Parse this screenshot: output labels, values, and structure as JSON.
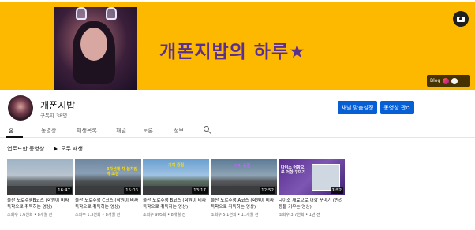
{
  "banner": {
    "title": "개폰지밥의 하루★",
    "links_label": "Blog",
    "camera_icon": "camera-icon",
    "colors": {
      "background": "#fdb800",
      "title": "#5a2f8f"
    }
  },
  "channel": {
    "name": "개폰지밥",
    "subscribers": "구독자 38명",
    "customize_button": "채널 맞춤설정",
    "manage_button": "동영상 관리",
    "accent": "#065fd4"
  },
  "tabs": [
    "홈",
    "동영상",
    "재생목록",
    "채널",
    "토론",
    "정보"
  ],
  "active_tab": "홈",
  "section": {
    "title": "업로드한 동영상",
    "play_all": "모두 재생"
  },
  "videos": [
    {
      "title": "울산 도로주행B코스 (학원이 비싸 독학으로 취득하는 영상)",
      "meta": "조회수 1.6천회 • 8개월 전",
      "duration": "16:47",
      "overlay": ""
    },
    {
      "title": "울산 도로주행 C코스 (학원이 비싸 독학으로 취득하는 영상)",
      "meta": "조회수 1.3천회 • 8개월 전",
      "duration": "15:03",
      "overlay": "3차선에 차 늘지않게 조심"
    },
    {
      "title": "울산 도로주행 B코스 (학원이 비싸 독학으로 취득하는 영상)",
      "meta": "조회수 905회 • 8개월 전",
      "duration": "13:17",
      "overlay": "기어 중립"
    },
    {
      "title": "울산 도로주행 A코스 (학원이 비싸 독학으로 취득하는 영상)",
      "meta": "조회수 5.1천회 • 11개월 전",
      "duration": "12:52",
      "overlay": "기어 중립"
    },
    {
      "title": "다이소 재료으로 어항 꾸미기 (반려동물 키우는 영상)",
      "meta": "조회수 3.7천회 • 1년 전",
      "duration": "1:52",
      "overlay": "다이소 어항으로 어항 꾸미기"
    }
  ]
}
